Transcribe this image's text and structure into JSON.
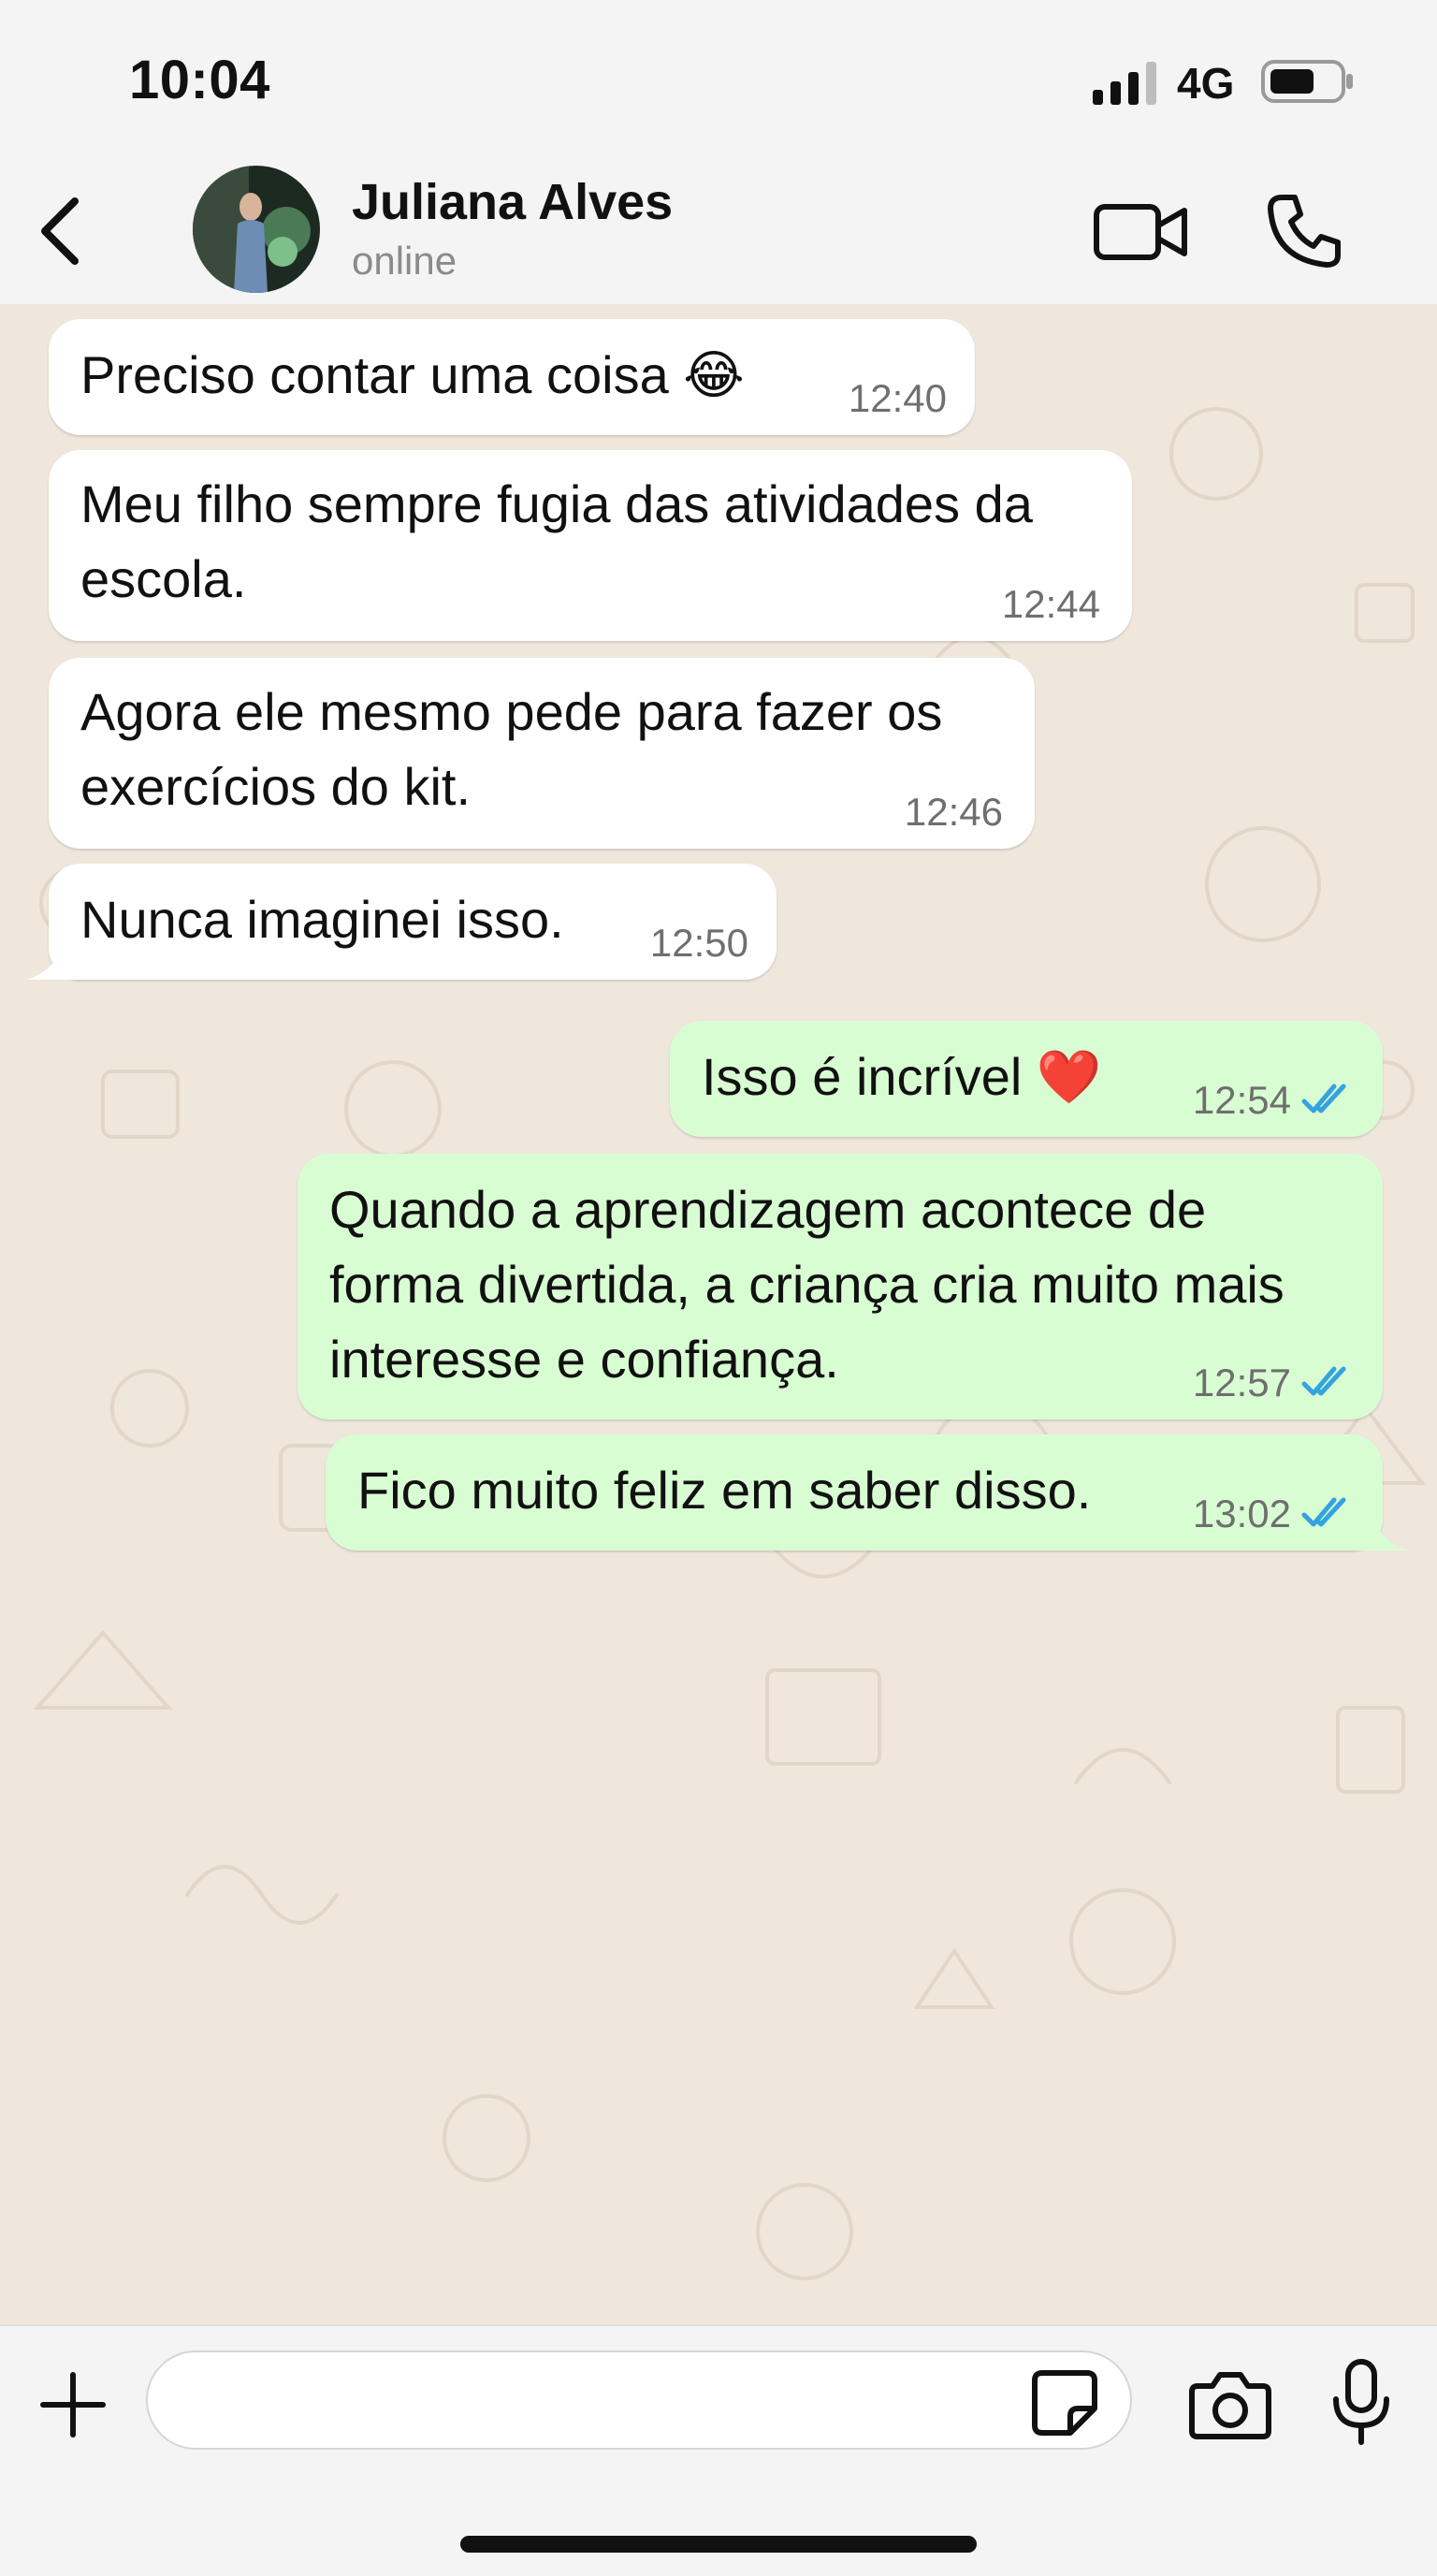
{
  "status_bar": {
    "time": "10:04",
    "network": "4G",
    "icons": [
      "signal-bars-icon",
      "battery-icon"
    ]
  },
  "header": {
    "back_icon": "chevron-left-icon",
    "contact_name": "Juliana Alves",
    "contact_status": "online",
    "actions": [
      "video-camera-icon",
      "phone-icon"
    ]
  },
  "messages": [
    {
      "direction": "incoming",
      "text": "Preciso contar uma coisa 😂",
      "time": "12:40"
    },
    {
      "direction": "incoming",
      "text": "Meu filho sempre fugia das atividades da\nescola.",
      "time": "12:44"
    },
    {
      "direction": "incoming",
      "text": "Agora ele mesmo pede para fazer os\nexercícios do kit.",
      "time": "12:46"
    },
    {
      "direction": "incoming",
      "text": "Nunca imaginei isso.",
      "time": "12:50"
    },
    {
      "direction": "outgoing",
      "text": "Isso é incrível ❤️",
      "time": "12:54",
      "status": "read"
    },
    {
      "direction": "outgoing",
      "text": "Quando a aprendizagem acontece de\nforma divertida, a criança cria muito mais\ninteresse e confiança.",
      "time": "12:57",
      "status": "read"
    },
    {
      "direction": "outgoing",
      "text": "Fico muito feliz em saber disso.",
      "time": "13:02",
      "status": "read"
    }
  ],
  "composer": {
    "placeholder": "",
    "icons": [
      "plus-icon",
      "sticker-icon",
      "camera-icon",
      "microphone-icon"
    ]
  },
  "colors": {
    "incoming_bubble": "#ffffff",
    "outgoing_bubble": "#d9fdd3",
    "read_ticks": "#34a3e0",
    "wallpaper": "#efe6dc"
  }
}
